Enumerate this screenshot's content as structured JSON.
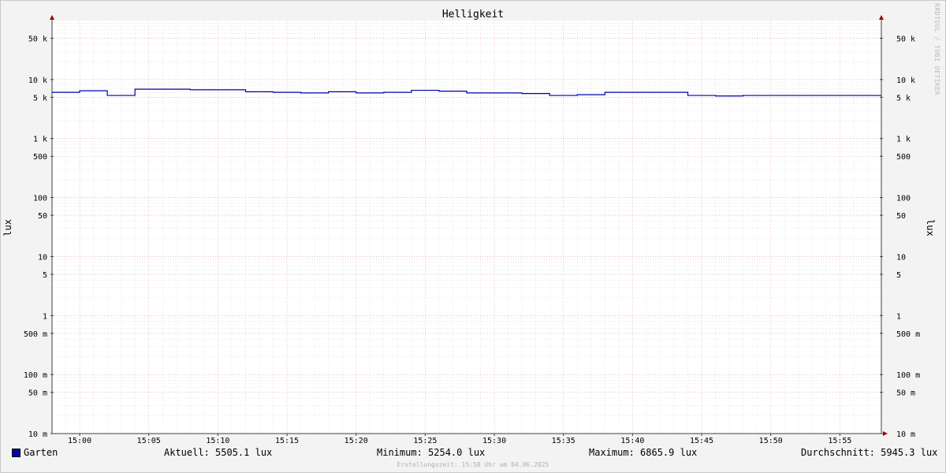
{
  "chart_data": {
    "type": "line",
    "title": "Helligkeit",
    "ylabel": "lux",
    "y_scale": "log",
    "ylim": [
      0.01,
      100000
    ],
    "y_ticks": [
      {
        "value": 0.01,
        "label": "10 m"
      },
      {
        "value": 0.05,
        "label": "50 m"
      },
      {
        "value": 0.1,
        "label": "100 m"
      },
      {
        "value": 0.5,
        "label": "500 m"
      },
      {
        "value": 1,
        "label": "1"
      },
      {
        "value": 5,
        "label": "5"
      },
      {
        "value": 10,
        "label": "10"
      },
      {
        "value": 50,
        "label": "50"
      },
      {
        "value": 100,
        "label": "100"
      },
      {
        "value": 500,
        "label": "500"
      },
      {
        "value": 1000,
        "label": "1 k"
      },
      {
        "value": 5000,
        "label": "5 k"
      },
      {
        "value": 10000,
        "label": "10 k"
      },
      {
        "value": 50000,
        "label": "50 k"
      }
    ],
    "xlim": [
      "14:58",
      "15:58"
    ],
    "x_ticks": [
      "15:00",
      "15:05",
      "15:10",
      "15:15",
      "15:20",
      "15:25",
      "15:30",
      "15:35",
      "15:40",
      "15:45",
      "15:50",
      "15:55"
    ],
    "grid": true,
    "series": [
      {
        "name": "Garten",
        "color": "#0000a8",
        "points": [
          [
            "14:58",
            6060
          ],
          [
            "15:00",
            6450
          ],
          [
            "15:02",
            5370
          ],
          [
            "15:04",
            6860
          ],
          [
            "15:08",
            6700
          ],
          [
            "15:12",
            6200
          ],
          [
            "15:14",
            6060
          ],
          [
            "15:16",
            5920
          ],
          [
            "15:18",
            6200
          ],
          [
            "15:20",
            5920
          ],
          [
            "15:22",
            6060
          ],
          [
            "15:24",
            6560
          ],
          [
            "15:26",
            6350
          ],
          [
            "15:28",
            5920
          ],
          [
            "15:32",
            5790
          ],
          [
            "15:34",
            5370
          ],
          [
            "15:36",
            5530
          ],
          [
            "15:38",
            6060
          ],
          [
            "15:44",
            5370
          ],
          [
            "15:46",
            5254
          ],
          [
            "15:48",
            5370
          ],
          [
            "15:58",
            5505
          ]
        ]
      }
    ]
  },
  "watermark": "RRDTOOL / TOBI OETIKER",
  "legend": {
    "series_name": "Garten",
    "current": "Aktuell: 5505.1 lux",
    "minimum": "Minimum: 5254.0 lux",
    "maximum": "Maximum: 6865.9 lux",
    "average": "Durchschnitt: 5945.3 lux"
  },
  "footer": "Erstellungszeit: 15:58 Uhr am 04.06.2025"
}
